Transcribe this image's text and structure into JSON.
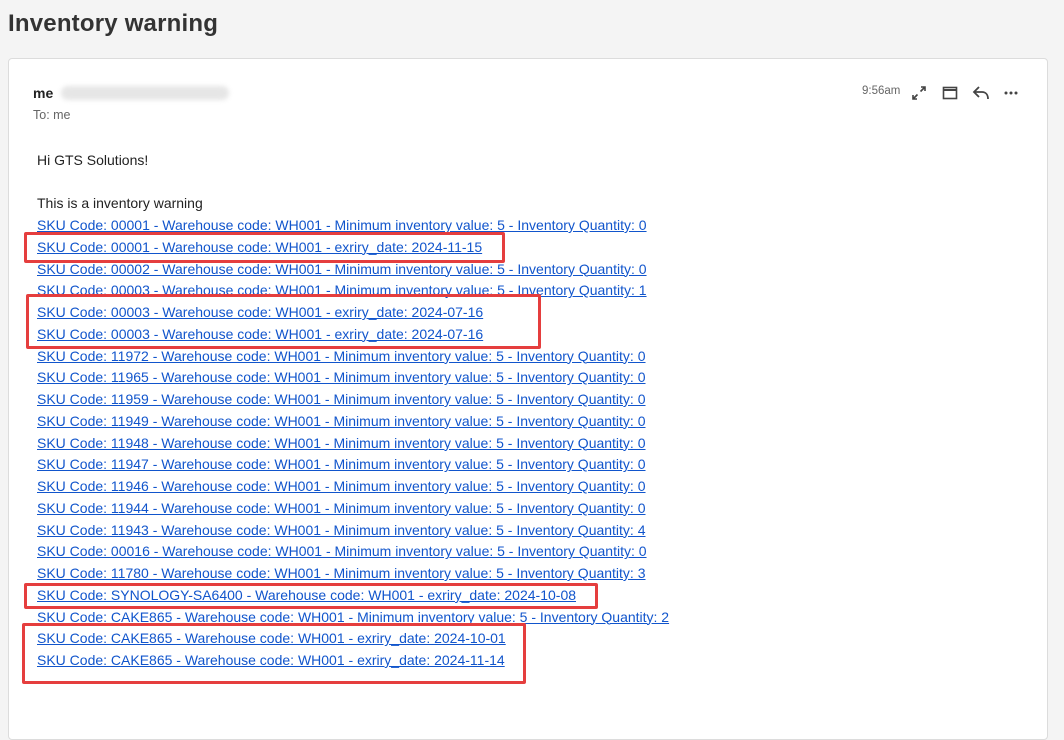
{
  "page_title": "Inventory warning",
  "email": {
    "sender": "me",
    "to_line": "To: me",
    "time": "9:56am",
    "actions": {
      "expand_icon": "expand-icon",
      "popout_icon": "popout-window-icon",
      "reply_icon": "reply-icon",
      "more_icon": "more-options-icon"
    },
    "greeting": "Hi GTS Solutions!",
    "intro": "This is a inventory warning",
    "lines": [
      "SKU Code: 00001 - Warehouse code: WH001 - Minimum inventory value: 5 - Inventory Quantity: 0",
      "SKU Code: 00001 - Warehouse code: WH001 - exriry_date: 2024-11-15",
      "SKU Code: 00002 - Warehouse code: WH001 - Minimum inventory value: 5 - Inventory Quantity: 0",
      "SKU Code: 00003 - Warehouse code: WH001 - Minimum inventory value: 5 - Inventory Quantity: 1",
      "SKU Code: 00003 - Warehouse code: WH001 - exriry_date: 2024-07-16",
      "SKU Code: 00003 - Warehouse code: WH001 - exriry_date: 2024-07-16",
      "SKU Code: 11972 - Warehouse code: WH001 - Minimum inventory value: 5 - Inventory Quantity: 0",
      "SKU Code: 11965 - Warehouse code: WH001 - Minimum inventory value: 5 - Inventory Quantity: 0",
      "SKU Code: 11959 - Warehouse code: WH001 - Minimum inventory value: 5 - Inventory Quantity: 0",
      "SKU Code: 11949 - Warehouse code: WH001 - Minimum inventory value: 5 - Inventory Quantity: 0",
      "SKU Code: 11948 - Warehouse code: WH001 - Minimum inventory value: 5 - Inventory Quantity: 0",
      "SKU Code: 11947 - Warehouse code: WH001 - Minimum inventory value: 5 - Inventory Quantity: 0",
      "SKU Code: 11946 - Warehouse code: WH001 - Minimum inventory value: 5 - Inventory Quantity: 0",
      "SKU Code: 11944 - Warehouse code: WH001 - Minimum inventory value: 5 - Inventory Quantity: 0",
      "SKU Code: 11943 - Warehouse code: WH001 - Minimum inventory value: 5 - Inventory Quantity: 4",
      "SKU Code: 00016 - Warehouse code: WH001 - Minimum inventory value: 5 - Inventory Quantity: 0",
      "SKU Code: 11780 - Warehouse code: WH001 - Minimum inventory value: 5 - Inventory Quantity: 3",
      "SKU Code: SYNOLOGY-SA6400 - Warehouse code: WH001 - exriry_date: 2024-10-08",
      "SKU Code: CAKE865 - Warehouse code: WH001 - Minimum inventory value: 5 - Inventory Quantity: 2",
      "SKU Code: CAKE865 - Warehouse code: WH001 - exriry_date: 2024-10-01",
      "SKU Code: CAKE865 - Warehouse code: WH001 - exriry_date: 2024-11-14"
    ]
  },
  "colors": {
    "link": "#1155cc",
    "highlight": "#e53e3e"
  }
}
